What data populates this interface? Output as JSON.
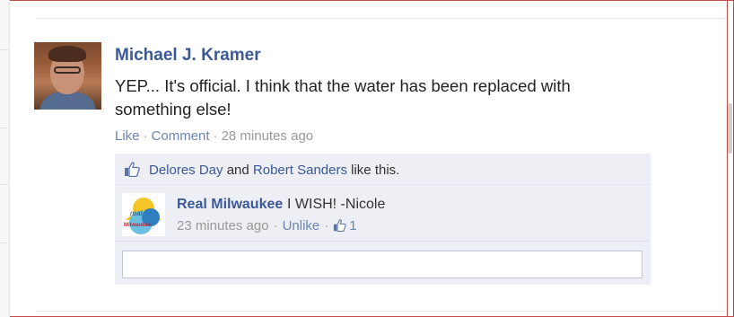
{
  "post": {
    "author": "Michael J. Kramer",
    "text": "YEP... It's official. I think that the water has been replaced with something else!",
    "actions": {
      "like": "Like",
      "comment": "Comment",
      "time": "28 minutes ago"
    }
  },
  "likes": {
    "person1": "Delores Day",
    "and": "and",
    "person2": "Robert Sanders",
    "suffix": "like this."
  },
  "comment": {
    "author": "Real Milwaukee",
    "text": "I WISH! -Nicole",
    "time": "23 minutes ago",
    "unlike": "Unlike",
    "like_count": "1",
    "logo_text_top": "real",
    "logo_text_bottom": "Milwaukee"
  },
  "reply": {
    "placeholder": ""
  },
  "colors": {
    "link": "#3b5998",
    "frame": "#c44a4a",
    "comment_bg": "#edeff4"
  },
  "icons": {
    "like": "thumbs-up-icon"
  }
}
